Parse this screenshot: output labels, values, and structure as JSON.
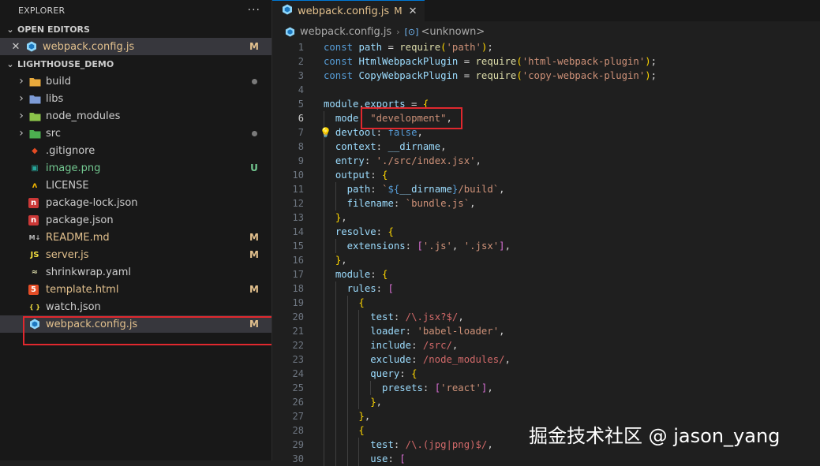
{
  "explorer": {
    "title": "EXPLORER",
    "more": "···"
  },
  "open_editors": {
    "heading": "OPEN EDITORS",
    "items": [
      {
        "name": "webpack.config.js",
        "badge": "M"
      }
    ]
  },
  "project": {
    "heading": "LIGHTHOUSE_DEMO",
    "items": [
      {
        "name": "build",
        "kind": "folder",
        "badge": "dot"
      },
      {
        "name": "libs",
        "kind": "folder",
        "badge": ""
      },
      {
        "name": "node_modules",
        "kind": "folder",
        "badge": ""
      },
      {
        "name": "src",
        "kind": "folder",
        "badge": "dot"
      },
      {
        "name": ".gitignore",
        "kind": "file",
        "badge": ""
      },
      {
        "name": "image.png",
        "kind": "file",
        "badge": "U"
      },
      {
        "name": "LICENSE",
        "kind": "file",
        "badge": ""
      },
      {
        "name": "package-lock.json",
        "kind": "file",
        "badge": ""
      },
      {
        "name": "package.json",
        "kind": "file",
        "badge": ""
      },
      {
        "name": "README.md",
        "kind": "file",
        "badge": "M"
      },
      {
        "name": "server.js",
        "kind": "file",
        "badge": "M"
      },
      {
        "name": "shrinkwrap.yaml",
        "kind": "file",
        "badge": ""
      },
      {
        "name": "template.html",
        "kind": "file",
        "badge": "M"
      },
      {
        "name": "watch.json",
        "kind": "file",
        "badge": ""
      },
      {
        "name": "webpack.config.js",
        "kind": "file",
        "badge": "M"
      }
    ]
  },
  "tab": {
    "label": "webpack.config.js",
    "modified": "M",
    "close": "✕"
  },
  "breadcrumb": {
    "file": "webpack.config.js",
    "symbol": "<unknown>"
  },
  "watermark": "掘金技术社区 @ jason_yang",
  "colors": {
    "modified": "#e2c08d",
    "untracked": "#73c991",
    "highlight": "#e0282e",
    "accent": "#0078d4"
  },
  "code": {
    "active_line": 6,
    "lines": [
      "const path = require('path');",
      "const HtmlWebpackPlugin = require('html-webpack-plugin');",
      "const CopyWebpackPlugin = require('copy-webpack-plugin');",
      "",
      "module.exports = {",
      "  mode: \"development\",",
      "  devtool: false,",
      "  context: __dirname,",
      "  entry: './src/index.jsx',",
      "  output: {",
      "    path: `${__dirname}/build`,",
      "    filename: `bundle.js`,",
      "  },",
      "  resolve: {",
      "    extensions: ['.js', '.jsx'],",
      "  },",
      "  module: {",
      "    rules: [",
      "      {",
      "        test: /\\.jsx?$/,",
      "        loader: 'babel-loader',",
      "        include: /src/,",
      "        exclude: /node_modules/,",
      "        query: {",
      "          presets: ['react'],",
      "        },",
      "      },",
      "      {",
      "        test: /\\.(jpg|png)$/,",
      "        use: ["
    ]
  }
}
